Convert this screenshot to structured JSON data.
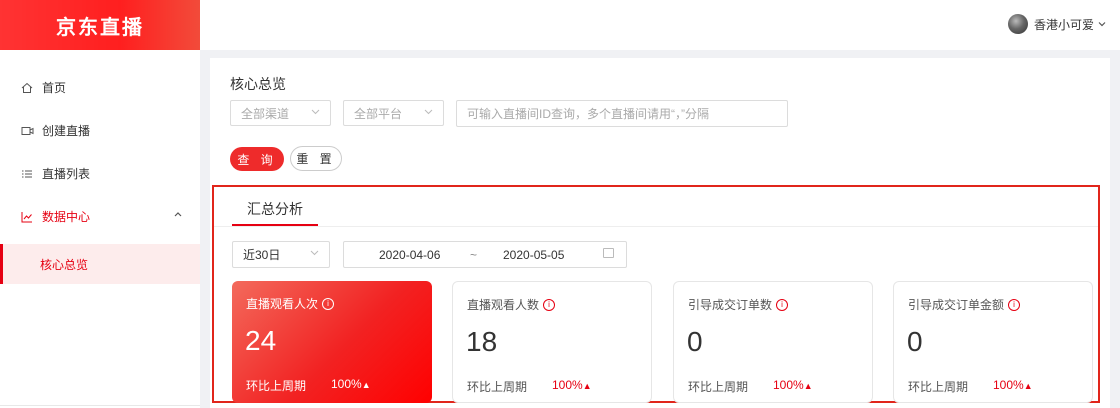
{
  "sidebar": {
    "logo": "京东直播",
    "items": [
      {
        "label": "首页",
        "icon": "home-icon"
      },
      {
        "label": "创建直播",
        "icon": "video-camera-icon"
      },
      {
        "label": "直播列表",
        "icon": "list-icon"
      },
      {
        "label": "数据中心",
        "icon": "line-chart-icon"
      }
    ],
    "sub_items": [
      {
        "label": "核心总览"
      }
    ]
  },
  "header": {
    "username": "香港小可爱"
  },
  "filters": {
    "title": "核心总览",
    "channel": "全部渠道",
    "platform": "全部平台",
    "search_placeholder": "可输入直播间ID查询，多个直播间请用“，”分隔",
    "query_label": "查 询",
    "reset_label": "重 置"
  },
  "summary": {
    "tab": "汇总分析",
    "period": "近30日",
    "date_start": "2020-04-06",
    "date_sep": "~",
    "date_end": "2020-05-05",
    "cards": [
      {
        "label": "直播观看人次",
        "value": "24",
        "compare_label": "环比上周期",
        "change": "100%",
        "trend": "up"
      },
      {
        "label": "直播观看人数",
        "value": "18",
        "compare_label": "环比上周期",
        "change": "100%",
        "trend": "up"
      },
      {
        "label": "引导成交订单数",
        "value": "0",
        "compare_label": "环比上周期",
        "change": "100%",
        "trend": "up"
      },
      {
        "label": "引导成交订单金额",
        "value": "0",
        "compare_label": "环比上周期",
        "change": "100%",
        "trend": "up"
      }
    ]
  },
  "colors": {
    "accent": "#e60012",
    "highlight_card": "#f22222"
  }
}
